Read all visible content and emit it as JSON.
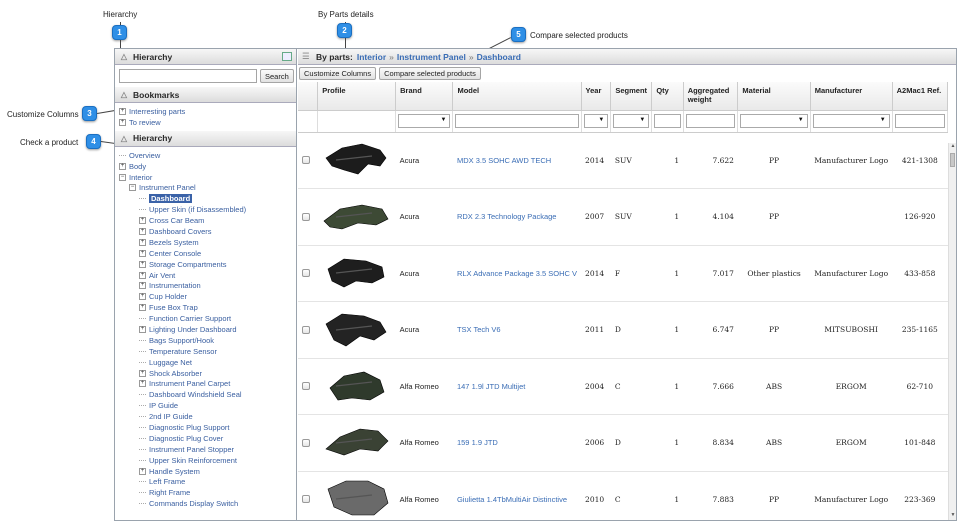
{
  "callouts": {
    "c1": {
      "num": "1",
      "text": "Hierarchy"
    },
    "c2": {
      "num": "2",
      "text": "By Parts details"
    },
    "c3": {
      "num": "3",
      "text": "Customize Columns"
    },
    "c4": {
      "num": "4",
      "text": "Check a product"
    },
    "c5": {
      "num": "5",
      "text": "Compare selected products"
    }
  },
  "left": {
    "hierarchy_title": "Hierarchy",
    "search_button": "Search",
    "search_value": "",
    "bookmarks_title": "Bookmarks",
    "bookmarks": [
      "Interresting parts",
      "To review"
    ],
    "hierarchy2_title": "Hierarchy",
    "tree": [
      {
        "label": "Overview",
        "level": 0,
        "type": "leaf"
      },
      {
        "label": "Body",
        "level": 0,
        "type": "collapsed"
      },
      {
        "label": "Interior",
        "level": 0,
        "type": "expanded"
      },
      {
        "label": "Instrument Panel",
        "level": 1,
        "type": "expanded"
      },
      {
        "label": "Dashboard",
        "level": 2,
        "type": "leaf",
        "selected": true
      },
      {
        "label": "Upper Skin (if Disassembled)",
        "level": 2,
        "type": "leaf"
      },
      {
        "label": "Cross Car Beam",
        "level": 2,
        "type": "collapsed"
      },
      {
        "label": "Dashboard Covers",
        "level": 2,
        "type": "collapsed"
      },
      {
        "label": "Bezels System",
        "level": 2,
        "type": "collapsed"
      },
      {
        "label": "Center Console",
        "level": 2,
        "type": "collapsed"
      },
      {
        "label": "Storage Compartments",
        "level": 2,
        "type": "collapsed"
      },
      {
        "label": "Air Vent",
        "level": 2,
        "type": "collapsed"
      },
      {
        "label": "Instrumentation",
        "level": 2,
        "type": "collapsed"
      },
      {
        "label": "Cup Holder",
        "level": 2,
        "type": "collapsed"
      },
      {
        "label": "Fuse Box Trap",
        "level": 2,
        "type": "collapsed"
      },
      {
        "label": "Function Carrier Support",
        "level": 2,
        "type": "leaf"
      },
      {
        "label": "Lighting Under Dashboard",
        "level": 2,
        "type": "collapsed"
      },
      {
        "label": "Bags Support/Hook",
        "level": 2,
        "type": "leaf"
      },
      {
        "label": "Temperature Sensor",
        "level": 2,
        "type": "leaf"
      },
      {
        "label": "Luggage Net",
        "level": 2,
        "type": "leaf"
      },
      {
        "label": "Shock Absorber",
        "level": 2,
        "type": "collapsed"
      },
      {
        "label": "Instrument Panel Carpet",
        "level": 2,
        "type": "collapsed"
      },
      {
        "label": "Dashboard Windshield Seal",
        "level": 2,
        "type": "leaf"
      },
      {
        "label": "IP Guide",
        "level": 2,
        "type": "leaf"
      },
      {
        "label": "2nd IP Guide",
        "level": 2,
        "type": "leaf"
      },
      {
        "label": "Diagnostic Plug Support",
        "level": 2,
        "type": "leaf"
      },
      {
        "label": "Diagnostic Plug Cover",
        "level": 2,
        "type": "leaf"
      },
      {
        "label": "Instrument Panel Stopper",
        "level": 2,
        "type": "leaf"
      },
      {
        "label": "Upper Skin Reinforcement",
        "level": 2,
        "type": "leaf"
      },
      {
        "label": "Handle System",
        "level": 2,
        "type": "collapsed"
      },
      {
        "label": "Left Frame",
        "level": 2,
        "type": "leaf"
      },
      {
        "label": "Right Frame",
        "level": 2,
        "type": "leaf"
      },
      {
        "label": "Commands Display Switch",
        "level": 2,
        "type": "leaf"
      }
    ]
  },
  "right": {
    "title": "By parts:",
    "breadcrumb": [
      "Interior",
      "Instrument Panel",
      "Dashboard"
    ],
    "sep": "»",
    "customize_button": "Customize Columns",
    "compare_button": "Compare selected products",
    "columns": [
      "",
      "Profile",
      "Brand",
      "Model",
      "Year",
      "Segment",
      "Qty",
      "Aggregated weight",
      "Material",
      "Manufacturer",
      "A2Mac1 Ref."
    ],
    "rows": [
      {
        "brand": "Acura",
        "model": "MDX 3.5 SOHC AWD TECH",
        "year": "2014",
        "segment": "SUV",
        "qty": "1",
        "weight": "7.622",
        "material": "PP",
        "manufacturer": "Manufacturer Logo",
        "ref": "421-1308"
      },
      {
        "brand": "Acura",
        "model": "RDX 2.3 Technology Package",
        "year": "2007",
        "segment": "SUV",
        "qty": "1",
        "weight": "4.104",
        "material": "PP",
        "manufacturer": "",
        "ref": "126-920"
      },
      {
        "brand": "Acura",
        "model": "RLX Advance Package 3.5 SOHC V",
        "year": "2014",
        "segment": "F",
        "qty": "1",
        "weight": "7.017",
        "material": "Other plastics",
        "manufacturer": "Manufacturer Logo",
        "ref": "433-858"
      },
      {
        "brand": "Acura",
        "model": "TSX Tech V6",
        "year": "2011",
        "segment": "D",
        "qty": "1",
        "weight": "6.747",
        "material": "PP",
        "manufacturer": "MITSUBOSHI",
        "ref": "235-1165"
      },
      {
        "brand": "Alfa Romeo",
        "model": "147 1.9l JTD Multijet",
        "year": "2004",
        "segment": "C",
        "qty": "1",
        "weight": "7.666",
        "material": "ABS",
        "manufacturer": "ERGOM",
        "ref": "62-710"
      },
      {
        "brand": "Alfa Romeo",
        "model": "159 1.9 JTD",
        "year": "2006",
        "segment": "D",
        "qty": "1",
        "weight": "8.834",
        "material": "ABS",
        "manufacturer": "ERGOM",
        "ref": "101-848"
      },
      {
        "brand": "Alfa Romeo",
        "model": "Giulietta 1.4TbMultiAir Distinctive",
        "year": "2010",
        "segment": "C",
        "qty": "1",
        "weight": "7.883",
        "material": "PP",
        "manufacturer": "Manufacturer Logo",
        "ref": "223-369"
      }
    ]
  },
  "colors": {
    "accent": "#2f8fe6",
    "link": "#3a6db5",
    "selected": "#3a62a8"
  }
}
